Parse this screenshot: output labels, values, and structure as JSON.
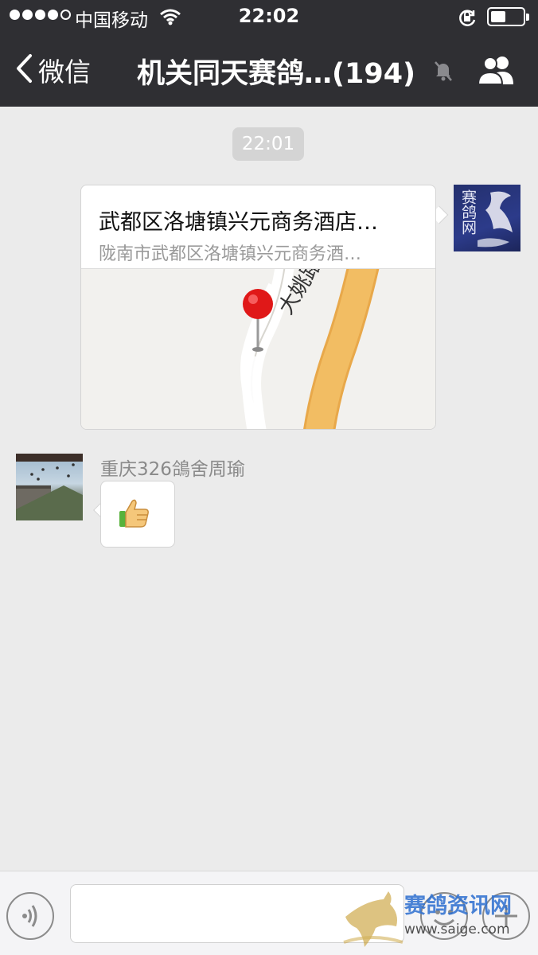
{
  "status_bar": {
    "carrier": "中国移动",
    "time": "22:02"
  },
  "nav": {
    "back_label": "微信",
    "title": "机关同天赛鸽…(194)"
  },
  "chat": {
    "timestamp": "22:01",
    "messages": [
      {
        "kind": "location",
        "from": "self",
        "avatar_text": "赛鸽网",
        "place_name": "武都区洛塘镇兴元商务酒店…",
        "address": "陇南市武都区洛塘镇兴元商务酒…",
        "map_road_label": "大姚路"
      },
      {
        "kind": "emoji",
        "from": "other",
        "sender": "重庆326鴿舍周瑜",
        "emoji": "thumbs-up"
      }
    ]
  },
  "input_bar": {
    "text_value": "",
    "watermark_line1": "赛鸽资讯网",
    "watermark_line2": "www.saige.com"
  },
  "colors": {
    "nav_bg": "#2f2f33",
    "chat_bg": "#ebebeb",
    "map_road": "#f2bd63"
  }
}
